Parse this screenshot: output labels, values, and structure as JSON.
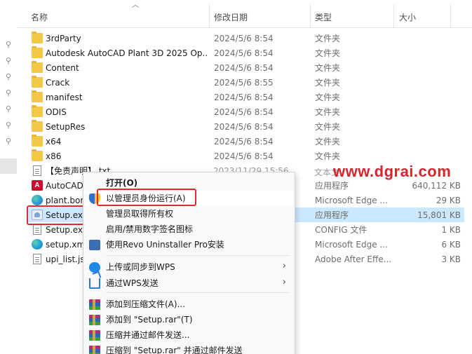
{
  "header": {
    "name": "名称",
    "date": "修改日期",
    "type": "类型",
    "size": "大小"
  },
  "files": [
    {
      "name": "3rdParty",
      "date": "2024/5/6 8:54",
      "type": "文件夹",
      "size": "",
      "icon": "folder-icon"
    },
    {
      "name": "Autodesk AutoCAD Plant 3D 2025 Op...",
      "date": "2024/5/6 8:54",
      "type": "文件夹",
      "size": "",
      "icon": "folder-icon"
    },
    {
      "name": "Content",
      "date": "2024/5/6 8:54",
      "type": "文件夹",
      "size": "",
      "icon": "folder-icon"
    },
    {
      "name": "Crack",
      "date": "2024/5/6 8:55",
      "type": "文件夹",
      "size": "",
      "icon": "folder-icon"
    },
    {
      "name": "manifest",
      "date": "2024/5/6 8:54",
      "type": "文件夹",
      "size": "",
      "icon": "folder-icon"
    },
    {
      "name": "ODIS",
      "date": "2024/5/6 8:54",
      "type": "文件夹",
      "size": "",
      "icon": "folder-icon"
    },
    {
      "name": "SetupRes",
      "date": "2024/5/6 8:54",
      "type": "文件夹",
      "size": "",
      "icon": "folder-icon"
    },
    {
      "name": "x64",
      "date": "2024/5/6 8:54",
      "type": "文件夹",
      "size": "",
      "icon": "folder-icon"
    },
    {
      "name": "x86",
      "date": "2024/5/6 8:54",
      "type": "文件夹",
      "size": "",
      "icon": "folder-icon"
    },
    {
      "name": "【免责声明】.txt",
      "date": "",
      "type": "",
      "size": "",
      "icon": "text-file-icon"
    },
    {
      "name": "AutoCAD",
      "date": "",
      "type": "应用程序",
      "size": "640,112 KB",
      "icon": "autocad-icon"
    },
    {
      "name": "plant.bor",
      "date": "",
      "type": "Microsoft Edge ...",
      "size": "29 KB",
      "icon": "edge-icon"
    },
    {
      "name": "Setup.ex",
      "date": "",
      "type": "应用程序",
      "size": "15,801 KB",
      "icon": "setup-icon",
      "selected": true
    },
    {
      "name": "Setup.exe",
      "date": "",
      "type": "CONFIG 文件",
      "size": "1 KB",
      "icon": "text-file-icon"
    },
    {
      "name": "setup.xm",
      "date": "",
      "type": "Microsoft Edge ...",
      "size": "6 KB",
      "icon": "edge-icon"
    },
    {
      "name": "upi_list.js",
      "date": "",
      "type": "Adobe After Effe...",
      "size": "3 KB",
      "icon": "text-file-icon"
    }
  ],
  "watermark": {
    "text": "www.dgrai.com",
    "hidden_date": "2023/11/29 15:56",
    "hidden_type": "文本文"
  },
  "context_menu": {
    "items": [
      {
        "label": "打开(O)",
        "icon": "",
        "bold": true
      },
      {
        "label": "以管理员身份运行(A)",
        "icon": "uac-shield-icon",
        "highlighted": true
      },
      {
        "label": "管理员取得所有权",
        "icon": ""
      },
      {
        "label": "启用/禁用数字签名图标",
        "icon": ""
      },
      {
        "label": "使用Revo Uninstaller Pro安装",
        "icon": "revo-uninstaller-icon"
      },
      {
        "separator": true
      },
      {
        "label": "上传或同步到WPS",
        "icon": "wps-cloud-icon",
        "submenu": true
      },
      {
        "label": "通过WPS发送",
        "icon": "wps-share-icon",
        "submenu": true
      },
      {
        "separator": true
      },
      {
        "label": "添加到压缩文件(A)...",
        "icon": "winrar-icon"
      },
      {
        "label": "添加到 \"Setup.rar\"(T)",
        "icon": "winrar-icon"
      },
      {
        "label": "压缩并通过邮件发送...",
        "icon": "winrar-icon"
      },
      {
        "label": "压缩到 \"Setup.rar\" 并通过邮件发送",
        "icon": "winrar-icon"
      }
    ]
  },
  "colors": {
    "selection": "#cce8ff",
    "annotation": "#e02a2a",
    "watermark": "#d9232d",
    "folder": "#f3c74a"
  }
}
